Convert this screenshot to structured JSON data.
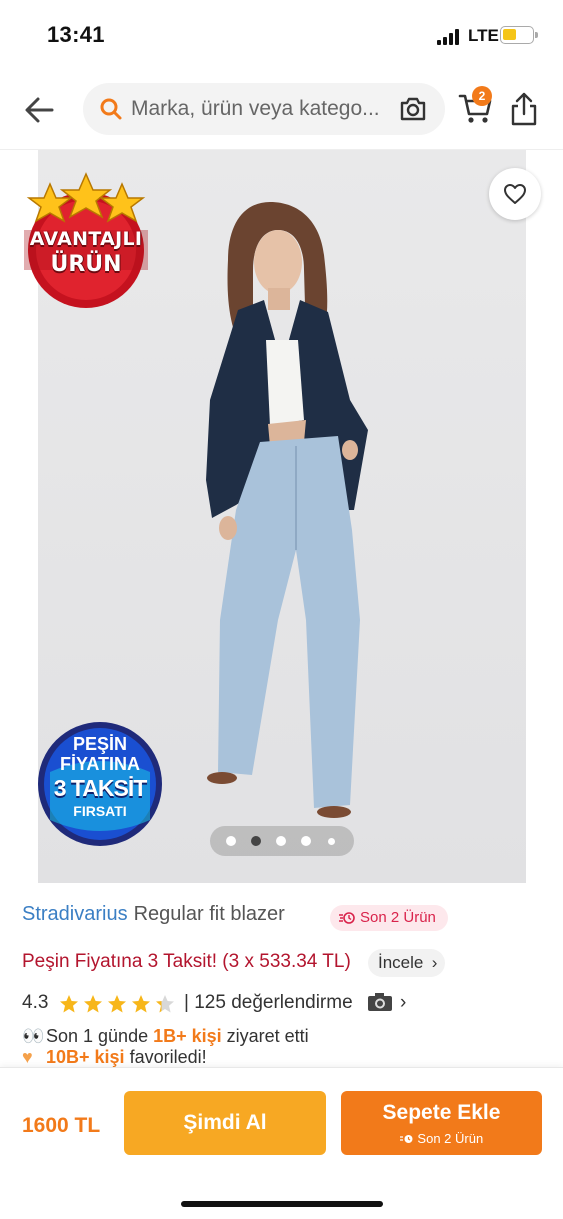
{
  "status_bar": {
    "time": "13:41",
    "network": "LTE",
    "battery_color": "#f5c518"
  },
  "nav": {
    "back_icon": "arrow-left-icon",
    "search_placeholder": "Marka, ürün veya katego...",
    "cart_badge": "2",
    "accent": "#f27a1a"
  },
  "product_image": {
    "badge_advantage": {
      "line1": "AVANTAJLI",
      "line2": "ÜRÜN"
    },
    "badge_installment": {
      "line1": "PEŞİN",
      "line2": "FİYATINA",
      "line3": "3 TAKSİT",
      "line4": "FIRSATI"
    },
    "carousel": {
      "count": 5,
      "active_index": 1
    }
  },
  "product": {
    "brand": "Stradivarius",
    "name": "Regular fit blazer",
    "stock_label": "Son 2 Ürün",
    "installment_text": "Peşin Fiyatına 3 Taksit! (3 x 533.34 TL)",
    "installment_link": "İncele",
    "rating": "4.3",
    "rating_stars": 4.3,
    "review_text": "| 125 değerlendirme",
    "social_visits_prefix": "Son 1 günde ",
    "social_visits_highlight": "1B+ kişi",
    "social_visits_suffix": " ziyaret etti",
    "social_fav_highlight": "10B+ kişi",
    "social_fav_suffix": " favoriledi!"
  },
  "bottom_bar": {
    "price": "1600 TL",
    "buy_now_label": "Şimdi Al",
    "add_to_cart_label": "Sepete Ekle",
    "add_to_cart_sub": "Son 2 Ürün"
  }
}
